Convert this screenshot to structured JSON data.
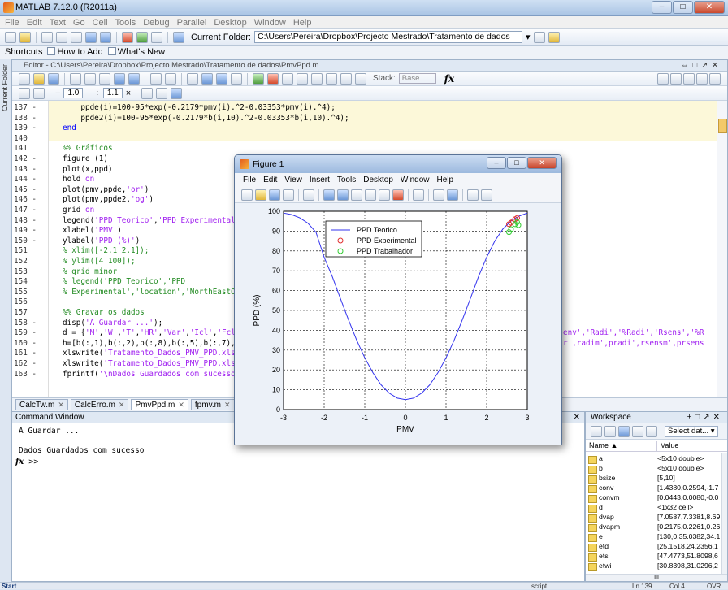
{
  "window": {
    "title": "MATLAB 7.12.0 (R2011a)"
  },
  "menu": [
    "File",
    "Edit",
    "Text",
    "Go",
    "Cell",
    "Tools",
    "Debug",
    "Parallel",
    "Desktop",
    "Window",
    "Help"
  ],
  "toolbar": {
    "current_folder_label": "Current Folder:",
    "current_folder": "C:\\Users\\Pereira\\Dropbox\\Projecto Mestrado\\Tratamento de dados"
  },
  "shortcuts": {
    "label": "Shortcuts",
    "how_to_add": "How to Add",
    "whats_new": "What's New"
  },
  "sidebar_label": "Current Folder",
  "editor": {
    "title": "Editor - C:\\Users\\Pereira\\Dropbox\\Projecto Mestrado\\Tratamento de dados\\PmvPpd.m",
    "cell_minus": "−",
    "cell_value1": "1.0",
    "cell_plus": "+",
    "cell_div": "÷",
    "cell_value2": "1.1",
    "cell_times": "×",
    "stack_label": "Stack:",
    "stack_value": "Base",
    "fx": "fx",
    "lines": [
      {
        "n": "137 -",
        "code": "    ppde(i)=100-95*exp(-0.2179*pmv(i).^2-0.03353*pmv(i).^4);"
      },
      {
        "n": "138 -",
        "code": "    ppde2(i)=100-95*exp(-0.2179*b(i,10).^2-0.03353*b(i,10).^4);"
      },
      {
        "n": "139 -",
        "code": "end"
      },
      {
        "n": "140",
        "code": ""
      },
      {
        "n": "141",
        "code": "%% Gráficos"
      },
      {
        "n": "142 -",
        "code": "figure (1)"
      },
      {
        "n": "143 -",
        "code": "plot(x,ppd)"
      },
      {
        "n": "144 -",
        "code": "hold on"
      },
      {
        "n": "145 -",
        "code": "plot(pmv,ppde,'or')"
      },
      {
        "n": "146 -",
        "code": "plot(pmv,ppde2,'og')"
      },
      {
        "n": "147 -",
        "code": "grid on"
      },
      {
        "n": "148 -",
        "code": "legend('PPD Teorico','PPD Experimental"
      },
      {
        "n": "149 -",
        "code": "xlabel('PMV')"
      },
      {
        "n": "150 -",
        "code": "ylabel('PPD (%)')"
      },
      {
        "n": "151",
        "code": "% xlim([-2.1 2.1]);"
      },
      {
        "n": "152",
        "code": "% ylim([4 100]);"
      },
      {
        "n": "153",
        "code": "% grid minor"
      },
      {
        "n": "154",
        "code": "% legend('PPD Teorico','PPD"
      },
      {
        "n": "155",
        "code": "% Experimental','location','NorthEastO"
      },
      {
        "n": "156",
        "code": ""
      },
      {
        "n": "157",
        "code": "%% Gravar os dados"
      },
      {
        "n": "158 -",
        "code": "disp('A Guardar ...');"
      },
      {
        "n": "159 -",
        "code": "d = {'M','W','T','HR','Var','Icl','Fcl"
      },
      {
        "n": "160 -",
        "code": "h=[b(:,1),b(:,2),b(:,8),b(:,5),b(:,7),"
      },
      {
        "n": "161 -",
        "code": "xlswrite('Tratamento_Dados_PMV_PPD.xls"
      },
      {
        "n": "162 -",
        "code": "xlswrite('Tratamento_Dados_PMV_PPD.xls"
      },
      {
        "n": "163 -",
        "code": "fprintf('\\nDados Guardados com sucesso"
      }
    ],
    "overflow_159": "env','Radi','%Radi','Rsens','%R",
    "overflow_160": "r',radim',pradi',rsensm',prsens",
    "tabs": [
      {
        "label": "CalcTw.m",
        "active": false
      },
      {
        "label": "CalcErro.m",
        "active": false
      },
      {
        "label": "PmvPpd.m",
        "active": true
      },
      {
        "label": "fpmv.m",
        "active": false
      }
    ]
  },
  "command_window": {
    "title": "Command Window",
    "output": "A Guardar ...\n\nDados Guardados com sucesso",
    "prompt": ">>"
  },
  "workspace": {
    "title": "Workspace",
    "select_data": "Select dat...",
    "col_name": "Name ▲",
    "col_value": "Value",
    "vars": [
      {
        "name": "a",
        "value": "<5x10 double>"
      },
      {
        "name": "b",
        "value": "<5x10 double>"
      },
      {
        "name": "bsize",
        "value": "[5,10]"
      },
      {
        "name": "conv",
        "value": "[1.4380,0.2594,-1.7"
      },
      {
        "name": "convm",
        "value": "[0.0443,0.0080,-0.0"
      },
      {
        "name": "d",
        "value": "<1x32 cell>"
      },
      {
        "name": "dvap",
        "value": "[7.0587,7.3381,8.69"
      },
      {
        "name": "dvapm",
        "value": "[0.2175,0.2261,0.26"
      },
      {
        "name": "e",
        "value": "[130,0,35.0382,34.1"
      },
      {
        "name": "etd",
        "value": "[25.1518,24.2356,1"
      },
      {
        "name": "etsi",
        "value": "[47.4773,51.8098,6"
      },
      {
        "name": "etwi",
        "value": "[30.8398,31.0296,2"
      }
    ]
  },
  "statusbar": {
    "start": "Start",
    "mode": "script",
    "ln": "Ln  139",
    "col": "Col  4",
    "ovr": "OVR"
  },
  "figure": {
    "title": "Figure 1",
    "menu": [
      "File",
      "Edit",
      "View",
      "Insert",
      "Tools",
      "Desktop",
      "Window",
      "Help"
    ]
  },
  "colors": {
    "theory": "#3333ee",
    "experimental": "#e03030",
    "worker": "#33cc33"
  },
  "chart_data": {
    "type": "line",
    "xlabel": "PMV",
    "ylabel": "PPD (%)",
    "xlim": [
      -3,
      3
    ],
    "ylim": [
      0,
      100
    ],
    "xticks": [
      -3,
      -2,
      -1,
      0,
      1,
      2,
      3
    ],
    "yticks": [
      0,
      10,
      20,
      30,
      40,
      50,
      60,
      70,
      80,
      90,
      100
    ],
    "grid": true,
    "legend": "top-left",
    "series": [
      {
        "name": "PPD Teorico",
        "style": "line",
        "x": [
          -3,
          -2.8,
          -2.6,
          -2.4,
          -2.2,
          -2,
          -1.8,
          -1.6,
          -1.4,
          -1.2,
          -1,
          -0.8,
          -0.6,
          -0.4,
          -0.2,
          0,
          0.2,
          0.4,
          0.6,
          0.8,
          1,
          1.2,
          1.4,
          1.6,
          1.8,
          2,
          2.2,
          2.4,
          2.6,
          2.8,
          3
        ],
        "y": [
          99.1,
          98.3,
          96.7,
          94.0,
          89.4,
          76.8,
          67.1,
          56.0,
          45.2,
          35.0,
          26.1,
          18.6,
          12.5,
          8.3,
          5.8,
          5.0,
          5.8,
          8.3,
          12.5,
          18.6,
          26.1,
          35.0,
          45.2,
          56.0,
          67.1,
          76.8,
          85.0,
          91.1,
          95.1,
          97.6,
          99.1
        ]
      },
      {
        "name": "PPD Experimental",
        "style": "marker-o",
        "x": [
          2.55,
          2.6,
          2.65,
          2.7,
          2.75
        ],
        "y": [
          93.5,
          94.2,
          95.0,
          96.0,
          96.6
        ]
      },
      {
        "name": "PPD Trabalhador",
        "style": "marker-o",
        "x": [
          2.55,
          2.6,
          2.7,
          2.75,
          2.78
        ],
        "y": [
          89.5,
          91.0,
          93.5,
          94.5,
          93.0
        ]
      }
    ]
  }
}
